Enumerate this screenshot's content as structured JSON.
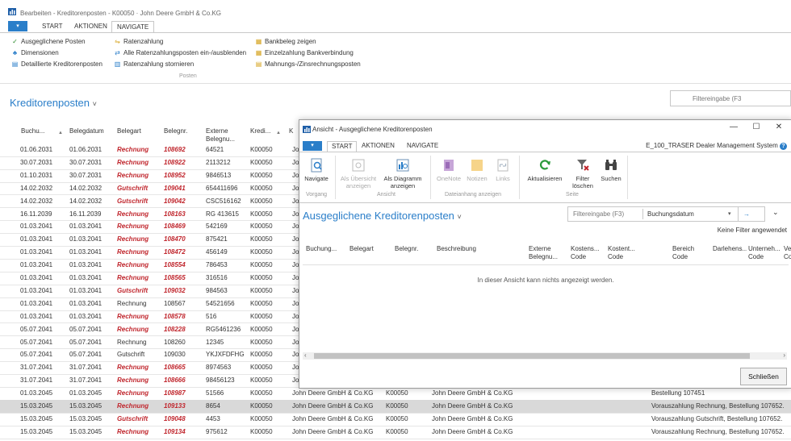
{
  "window": {
    "title": "Bearbeiten - Kreditorenposten - K00050 · John Deere GmbH & Co.KG"
  },
  "tabs": {
    "menu_glyph": "▾",
    "start": "START",
    "aktionen": "AKTIONEN",
    "navigate": "NAVIGATE"
  },
  "ribbon": {
    "col1": [
      "Ausgeglichene Posten",
      "Dimensionen",
      "Detaillierte Kreditorenposten"
    ],
    "col2": [
      "Ratenzahlung",
      "Alle Ratenzahlungsposten ein-/ausblenden",
      "Ratenzahlung stornieren"
    ],
    "col3": [
      "Bankbeleg zeigen",
      "Einzelzahlung Bankverbindung",
      "Mahnungs-/Zinsrechnungsposten"
    ],
    "group_label": "Posten"
  },
  "page": {
    "title": "Kreditorenposten",
    "title_chevron": "˅",
    "filter_placeholder": "Filtereingabe (F3"
  },
  "table": {
    "headers": {
      "buchung": "Buchu...",
      "belegdatum": "Belegdatum",
      "belegart": "Belegart",
      "belegnr": "Belegnr.",
      "extern": "Externe Belegnu...",
      "kredi": "Kredi...",
      "k": "K"
    },
    "rows": [
      {
        "d1": "01.06.2031",
        "d2": "01.06.2031",
        "art": "Rechnung",
        "nr": "108692",
        "ext": "64521",
        "kred": "K00050",
        "name": "Jo",
        "hl": true
      },
      {
        "d1": "30.07.2031",
        "d2": "30.07.2031",
        "art": "Rechnung",
        "nr": "108922",
        "ext": "2113212",
        "kred": "K00050",
        "name": "Jo",
        "hl": true
      },
      {
        "d1": "01.10.2031",
        "d2": "30.07.2031",
        "art": "Rechnung",
        "nr": "108952",
        "ext": "9846513",
        "kred": "K00050",
        "name": "Jo",
        "hl": true
      },
      {
        "d1": "14.02.2032",
        "d2": "14.02.2032",
        "art": "Gutschrift",
        "nr": "109041",
        "ext": "654411696",
        "kred": "K00050",
        "name": "Jo",
        "hl": true
      },
      {
        "d1": "14.02.2032",
        "d2": "14.02.2032",
        "art": "Gutschrift",
        "nr": "109042",
        "ext": "CSC516162",
        "kred": "K00050",
        "name": "Jo",
        "hl": true
      },
      {
        "d1": "16.11.2039",
        "d2": "16.11.2039",
        "art": "Rechnung",
        "nr": "108163",
        "ext": "RG 413615",
        "kred": "K00050",
        "name": "Jo",
        "hl": true
      },
      {
        "d1": "01.03.2041",
        "d2": "01.03.2041",
        "art": "Rechnung",
        "nr": "108469",
        "ext": "542169",
        "kred": "K00050",
        "name": "Jo",
        "hl": true
      },
      {
        "d1": "01.03.2041",
        "d2": "01.03.2041",
        "art": "Rechnung",
        "nr": "108470",
        "ext": "875421",
        "kred": "K00050",
        "name": "Jo",
        "hl": true
      },
      {
        "d1": "01.03.2041",
        "d2": "01.03.2041",
        "art": "Rechnung",
        "nr": "108472",
        "ext": "456149",
        "kred": "K00050",
        "name": "Jo",
        "hl": true
      },
      {
        "d1": "01.03.2041",
        "d2": "01.03.2041",
        "art": "Rechnung",
        "nr": "108554",
        "ext": "786453",
        "kred": "K00050",
        "name": "Jo",
        "hl": true
      },
      {
        "d1": "01.03.2041",
        "d2": "01.03.2041",
        "art": "Rechnung",
        "nr": "108565",
        "ext": "316516",
        "kred": "K00050",
        "name": "Jo",
        "hl": true
      },
      {
        "d1": "01.03.2041",
        "d2": "01.03.2041",
        "art": "Gutschrift",
        "nr": "109032",
        "ext": "984563",
        "kred": "K00050",
        "name": "Jo",
        "hl": true
      },
      {
        "d1": "01.03.2041",
        "d2": "01.03.2041",
        "art": "Rechnung",
        "nr": "108567",
        "ext": "54521656",
        "kred": "K00050",
        "name": "Jo",
        "hl": false
      },
      {
        "d1": "01.03.2041",
        "d2": "01.03.2041",
        "art": "Rechnung",
        "nr": "108578",
        "ext": "516",
        "kred": "K00050",
        "name": "Jo",
        "hl": true
      },
      {
        "d1": "05.07.2041",
        "d2": "05.07.2041",
        "art": "Rechnung",
        "nr": "108228",
        "ext": "RG5461236",
        "kred": "K00050",
        "name": "Jo",
        "hl": true
      },
      {
        "d1": "05.07.2041",
        "d2": "05.07.2041",
        "art": "Rechnung",
        "nr": "108260",
        "ext": "12345",
        "kred": "K00050",
        "name": "Jo",
        "hl": false
      },
      {
        "d1": "05.07.2041",
        "d2": "05.07.2041",
        "art": "Gutschrift",
        "nr": "109030",
        "ext": "YKJXFDFHG",
        "kred": "K00050",
        "name": "Jo",
        "hl": false
      },
      {
        "d1": "31.07.2041",
        "d2": "31.07.2041",
        "art": "Rechnung",
        "nr": "108665",
        "ext": "8974563",
        "kred": "K00050",
        "name": "Jo",
        "hl": true
      },
      {
        "d1": "31.07.2041",
        "d2": "31.07.2041",
        "art": "Rechnung",
        "nr": "108666",
        "ext": "98456123",
        "kred": "K00050",
        "name": "Jo",
        "hl": true
      },
      {
        "d1": "01.03.2045",
        "d2": "01.03.2045",
        "art": "Rechnung",
        "nr": "108987",
        "ext": "51566",
        "kred": "K00050",
        "name": "John Deere GmbH & Co.KG",
        "k2": "K00050",
        "name2": "John Deere GmbH & Co.KG",
        "desc": "Bestellung 107451",
        "hl": true
      },
      {
        "d1": "15.03.2045",
        "d2": "15.03.2045",
        "art": "Rechnung",
        "nr": "109133",
        "ext": "8654",
        "kred": "K00050",
        "name": "John Deere GmbH & Co.KG",
        "k2": "K00050",
        "name2": "John Deere GmbH & Co.KG",
        "desc": "Vorauszahlung Rechnung, Bestellung 107652.",
        "hl": true,
        "sel": true
      },
      {
        "d1": "15.03.2045",
        "d2": "15.03.2045",
        "art": "Gutschrift",
        "nr": "109048",
        "ext": "4453",
        "kred": "K00050",
        "name": "John Deere GmbH & Co.KG",
        "k2": "K00050",
        "name2": "John Deere GmbH & Co.KG",
        "desc": "Vorauszahlung Gutschrift, Bestellung 107652.",
        "hl": true
      },
      {
        "d1": "15.03.2045",
        "d2": "15.03.2045",
        "art": "Rechnung",
        "nr": "109134",
        "ext": "975612",
        "kred": "K00050",
        "name": "John Deere GmbH & Co.KG",
        "k2": "K00050",
        "name2": "John Deere GmbH & Co.KG",
        "desc": "Vorauszahlung Rechnung, Bestellung 107652.",
        "hl": true
      }
    ]
  },
  "dialog": {
    "title": "Ansicht - Ausgeglichene Kreditorenposten",
    "controls": {
      "min": "—",
      "max": "☐",
      "close": "✕"
    },
    "tabs": {
      "start": "START",
      "aktionen": "AKTIONEN",
      "navigate": "NAVIGATE"
    },
    "system_name": "E_100_TRASER Dealer Management System",
    "help": "?",
    "ribbon": {
      "navigate": "Navigate",
      "als_uebersicht": "Als Übersicht anzeigen",
      "als_diagramm": "Als Diagramm anzeigen",
      "onenote": "OneNote",
      "notizen": "Notizen",
      "links": "Links",
      "aktualisieren": "Aktualisieren",
      "filter_loeschen": "Filter löschen",
      "suchen": "Suchen",
      "group_vorgang": "Vorgang",
      "group_ansicht": "Ansicht",
      "group_dateianhang": "Dateianhang anzeigen",
      "group_seite": "Seite"
    },
    "page_title": "Ausgeglichene Kreditorenposten",
    "title_chevron": "˅",
    "filter_placeholder": "Filtereingabe (F3)",
    "filter_field": "Buchungsdatum",
    "no_filter": "Keine Filter angewendet",
    "headers": [
      "Buchung...",
      "Belegart",
      "Belegnr.",
      "Beschreibung",
      "Externe Belegnu...",
      "Kostens... Code",
      "Kostent... Code",
      "Bereich Code",
      "Darlehens...",
      "Unterneh... Code",
      "Ve Co"
    ],
    "empty_message": "In dieser Ansicht kann nichts angezeigt werden.",
    "close_button": "Schließen"
  },
  "colors": {
    "accent": "#2a7ec9",
    "red": "#c0262d",
    "selected_row": "#d9d9d9"
  }
}
